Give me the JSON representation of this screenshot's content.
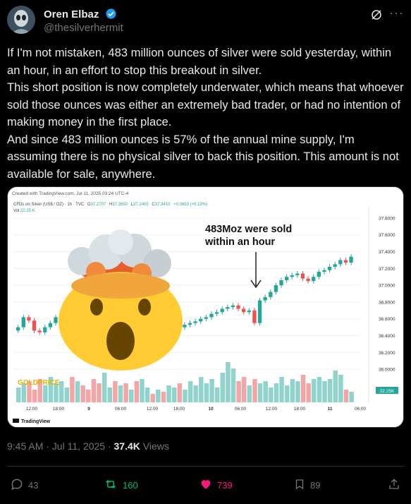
{
  "author": {
    "name": "Oren Elbaz",
    "handle": "@thesilverhermit"
  },
  "tweet": {
    "paragraphs": [
      "If I'm not mistaken, 483 million ounces of silver were sold yesterday, within an hour, in an effort to stop this breakout in silver.",
      "This short position is now completely underwater, which means that whoever sold those ounces was either an extremely bad trader, or had no intention of making money in the first place.",
      "And since 483 million ounces is 57% of the annual mine supply, I'm assuming there is no physical silver to back this position. This amount is not available for sale, anywhere."
    ]
  },
  "chart": {
    "created_with": "Created with TradingView.com, Jul 11, 2025 03:24 UTC-4",
    "symbol_line": "CFDs on Silver (US$ / OZ) · 1h · TVC",
    "ohlc": {
      "o_label": "O",
      "o": "37.2707",
      "h_label": "H",
      "h": "37.3650",
      "l_label": "L",
      "l": "37.2405",
      "c_label": "C",
      "c": "37.3410",
      "chg": "+0.0693 (+0.19%)"
    },
    "vol_label": "Vol",
    "vol_value": "22.25 K",
    "annotation_line1": "483Moz were sold",
    "annotation_line2": "within an hour",
    "watermark": "GOLDPRICE",
    "footer_logo": "TradingView",
    "price_ticks": [
      "37.8000",
      "37.6000",
      "37.4000",
      "37.2000",
      "37.0000",
      "36.8000",
      "36.6000",
      "36.4000",
      "36.2000",
      "36.0000"
    ],
    "vol_badge": "22.25K",
    "time_ticks": [
      "12:00",
      "18:00",
      "9",
      "06:00",
      "12:00",
      "18:00",
      "10",
      "06:00",
      "12:00",
      "18:00",
      "11",
      "06:00"
    ],
    "colors": {
      "up": "#26a69a",
      "down": "#ef5350",
      "vol_up": "#8fd3cc",
      "vol_down": "#f4a6a6"
    }
  },
  "chart_data": {
    "type": "candlestick",
    "title": "CFDs on Silver (US$ / OZ) · 1h · TVC",
    "ylim": [
      35.9,
      37.85
    ],
    "x": [
      "12:00",
      "18:00",
      "9",
      "06:00",
      "12:00",
      "18:00",
      "10",
      "06:00",
      "12:00",
      "18:00",
      "11",
      "06:00"
    ],
    "close": [
      36.5,
      36.62,
      36.58,
      36.46,
      36.44,
      36.5,
      36.55,
      36.62,
      36.66,
      36.7,
      36.68,
      36.74,
      36.52,
      36.42,
      36.36,
      36.35,
      36.38,
      36.41,
      36.4,
      36.43,
      36.42,
      36.45,
      36.44,
      36.46,
      36.47,
      36.45,
      36.49,
      36.48,
      36.5,
      36.52,
      36.5,
      36.53,
      36.55,
      36.57,
      36.6,
      36.62,
      36.66,
      36.68,
      36.72,
      36.74,
      36.76,
      36.72,
      36.68,
      36.7,
      36.55,
      36.82,
      36.86,
      36.92,
      37.0,
      37.06,
      37.1,
      37.12,
      37.14,
      37.08,
      37.05,
      37.1,
      37.16,
      37.18,
      37.22,
      37.25,
      37.3,
      37.27,
      37.34
    ],
    "volume_relative": [
      0.35,
      0.45,
      0.5,
      0.3,
      0.55,
      0.4,
      0.6,
      0.45,
      0.5,
      0.35,
      0.6,
      0.5,
      0.4,
      0.3,
      0.55,
      0.45,
      0.7,
      0.35,
      0.5,
      0.4,
      0.45,
      0.3,
      0.5,
      0.55,
      0.35,
      0.2,
      0.3,
      0.25,
      0.4,
      0.35,
      0.45,
      0.3,
      0.5,
      0.4,
      0.6,
      0.45,
      0.55,
      0.35,
      0.7,
      0.95,
      0.8,
      0.5,
      0.6,
      0.4,
      0.55,
      0.45,
      0.5,
      0.35,
      0.45,
      0.6,
      0.4,
      0.55,
      0.5,
      0.65,
      0.45,
      0.55,
      0.6,
      0.5,
      0.55,
      0.75,
      0.65,
      0.3,
      0.25
    ]
  },
  "footer": {
    "time": "9:45 AM · Jul 11, 2025 · ",
    "views_count": "37.4K",
    "views_label": " Views"
  },
  "actions": {
    "replies": "43",
    "reposts": "160",
    "likes": "739",
    "bookmarks": "89"
  }
}
